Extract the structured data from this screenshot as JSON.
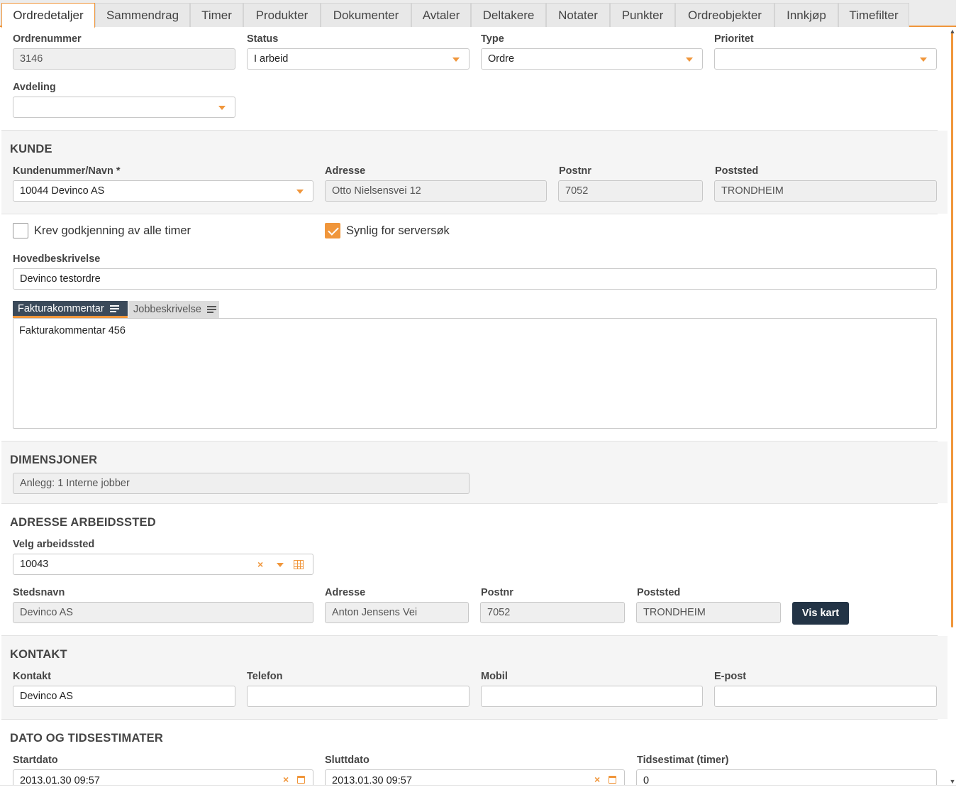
{
  "tabs": [
    "Ordredetaljer",
    "Sammendrag",
    "Timer",
    "Produkter",
    "Dokumenter",
    "Avtaler",
    "Deltakere",
    "Notater",
    "Punkter",
    "Ordreobjekter",
    "Innkjøp",
    "Timefilter"
  ],
  "active_tab": "Ordredetaljer",
  "order": {
    "ordrenummer_label": "Ordrenummer",
    "ordrenummer": "3146",
    "status_label": "Status",
    "status": "I arbeid",
    "type_label": "Type",
    "type": "Ordre",
    "prioritet_label": "Prioritet",
    "prioritet": "",
    "avdeling_label": "Avdeling",
    "avdeling": ""
  },
  "kunde": {
    "heading": "KUNDE",
    "kundenummer_label": "Kundenummer/Navn *",
    "kundenummer": "10044 Devinco AS",
    "adresse_label": "Adresse",
    "adresse": "Otto Nielsensvei 12",
    "postnr_label": "Postnr",
    "postnr": "7052",
    "poststed_label": "Poststed",
    "poststed": "TRONDHEIM"
  },
  "options": {
    "krev_godkjenning_label": "Krev godkjenning av alle timer",
    "krev_godkjenning": false,
    "synlig_label": "Synlig for serversøk",
    "synlig": true
  },
  "beskrivelse": {
    "hovedbeskrivelse_label": "Hovedbeskrivelse",
    "hovedbeskrivelse": "Devinco testordre",
    "subtab_faktura": "Fakturakommentar",
    "subtab_jobb": "Jobbeskrivelse",
    "faktura_text": "Fakturakommentar 456"
  },
  "dimensjoner": {
    "heading": "DIMENSJONER",
    "anlegg": "Anlegg: 1 Interne jobber"
  },
  "arbeidssted": {
    "heading": "ADRESSE ARBEIDSSTED",
    "velg_label": "Velg arbeidssted",
    "velg": "10043",
    "stedsnavn_label": "Stedsnavn",
    "stedsnavn": "Devinco AS",
    "adresse_label": "Adresse",
    "adresse": "Anton Jensens Vei",
    "postnr_label": "Postnr",
    "postnr": "7052",
    "poststed_label": "Poststed",
    "poststed": "TRONDHEIM",
    "vis_kart": "Vis kart"
  },
  "kontakt": {
    "heading": "KONTAKT",
    "kontakt_label": "Kontakt",
    "kontakt": "Devinco AS",
    "telefon_label": "Telefon",
    "telefon": "",
    "mobil_label": "Mobil",
    "mobil": "",
    "epost_label": "E-post",
    "epost": ""
  },
  "dato": {
    "heading": "DATO OG TIDSESTIMATER",
    "startdato_label": "Startdato",
    "startdato": "2013.01.30 09:57",
    "sluttdato_label": "Sluttdato",
    "sluttdato": "2013.01.30 09:57",
    "tidsestimat_label": "Tidsestimat (timer)",
    "tidsestimat": "0"
  },
  "colors": {
    "accent": "#f0963b",
    "dark_button": "#233446",
    "subtab_active": "#3b4a5a"
  },
  "icons": {
    "dropdown": "chevron-down-icon",
    "clear": "clear-icon",
    "grid": "grid-icon",
    "calendar": "calendar-icon",
    "richtext": "lines-icon"
  }
}
